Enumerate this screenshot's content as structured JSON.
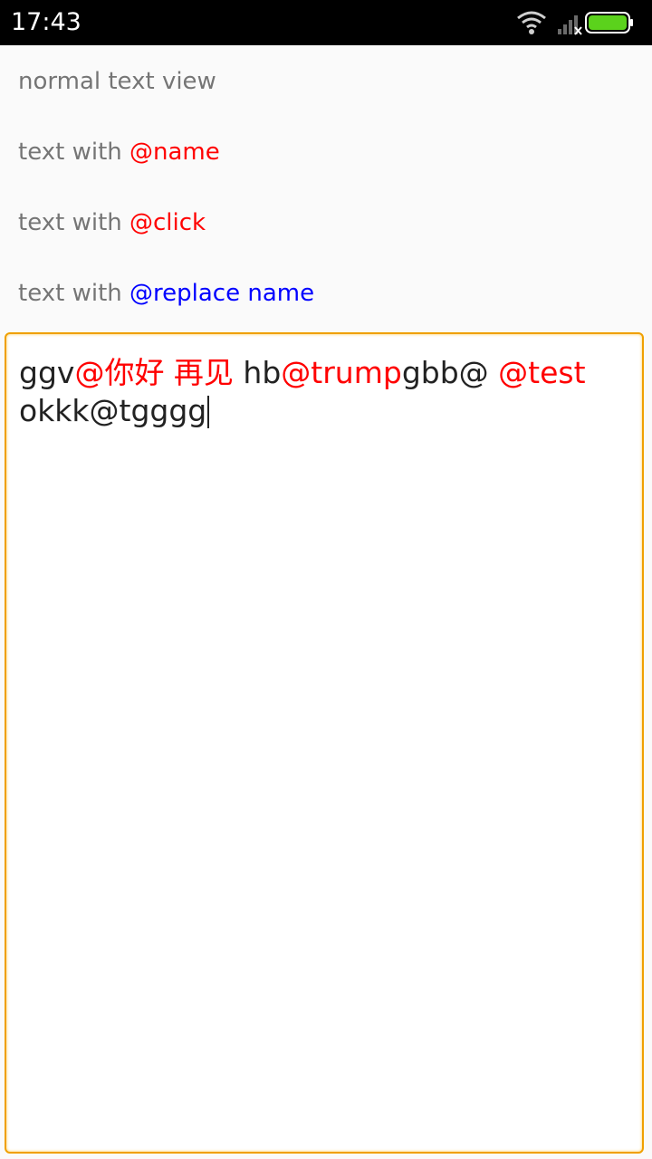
{
  "status_bar": {
    "time": "17:43",
    "icons": [
      "wifi-icon",
      "signal-icon",
      "battery-icon"
    ],
    "battery_color": "#5bd21c"
  },
  "rows": [
    {
      "prefix": "normal text view",
      "mention": "",
      "mention_color": ""
    },
    {
      "prefix": "text with ",
      "mention": "@name",
      "mention_color": "#ff0000"
    },
    {
      "prefix": "text with ",
      "mention": "@click",
      "mention_color": "#ff0000"
    },
    {
      "prefix": "text with ",
      "mention": "@replace name",
      "mention_color": "#0000ff"
    }
  ],
  "editor": {
    "border_color": "#f0a000",
    "line1": [
      {
        "text": "ggv",
        "mention": false
      },
      {
        "text": "@你好 再见",
        "mention": true
      },
      {
        "text": " hb",
        "mention": false
      },
      {
        "text": "@trump",
        "mention": true
      },
      {
        "text": "gbb@ ",
        "mention": false
      },
      {
        "text": "@test",
        "mention": true
      }
    ],
    "line2": "okkk@tgggg"
  }
}
